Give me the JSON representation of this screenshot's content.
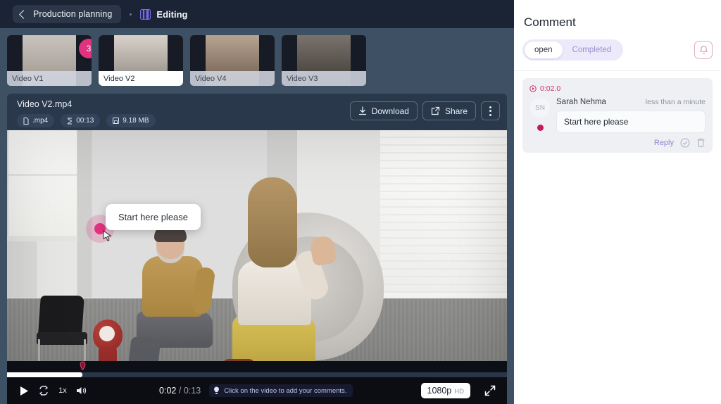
{
  "header": {
    "back_label": "Production planning",
    "back_icon": "chevron-left-icon",
    "separator": "•",
    "section_icon": "film-strip-icon",
    "section_label": "Editing"
  },
  "thumbnails": [
    {
      "label": "Video V1",
      "badge": "3",
      "selected": false
    },
    {
      "label": "Video V2",
      "badge": "",
      "selected": true
    },
    {
      "label": "Video V4",
      "badge": "",
      "selected": false
    },
    {
      "label": "Video V3",
      "badge": "",
      "selected": false
    }
  ],
  "file_info": {
    "name": "Video V2.mp4",
    "chips": [
      {
        "icon": "file-icon",
        "label": ".mp4"
      },
      {
        "icon": "hourglass-icon",
        "label": "00:13"
      },
      {
        "icon": "save-disk-icon",
        "label": "9.18 MB"
      }
    ],
    "download_label": "Download",
    "download_icon": "download-icon",
    "share_label": "Share",
    "share_icon": "external-link-icon",
    "more_icon": "kebab-menu-icon"
  },
  "player": {
    "play_icon": "play-icon",
    "loop_icon": "loop-icon",
    "speed_label": "1x",
    "volume_icon": "volume-icon",
    "current_time": "0:02",
    "time_separator": "/",
    "total_time": "0:13",
    "hint_icon": "lightbulb-icon",
    "hint_text": "Click on the video to add your comments.",
    "quality_label": "1080p",
    "quality_badge": "HD",
    "fullscreen_icon": "fullscreen-icon",
    "progress_percent": 15,
    "marker_percent": 15,
    "annotation_text": "Start here please",
    "annotation_icon": "comment-pin-icon",
    "cursor_icon": "pointer-cursor-icon"
  },
  "comments_panel": {
    "title": "Comment",
    "tabs": [
      {
        "label": "open",
        "active": true
      },
      {
        "label": "Completed",
        "active": false
      }
    ],
    "bell_icon": "bell-icon",
    "items": [
      {
        "timestamp": "0:02.0",
        "timestamp_icon": "play-circle-icon",
        "avatar_initials": "SN",
        "author": "Sarah Nehma",
        "age": "less than a minute",
        "text": "Start here please",
        "reply_label": "Reply",
        "resolve_icon": "check-circle-icon",
        "delete_icon": "trash-icon"
      }
    ]
  },
  "colors": {
    "accent_pink": "#e0327e",
    "accent_purple": "#7b6be8",
    "panel_dark": "#3e5064",
    "topbar_dark": "#1b2434",
    "comment_red": "#d0315f"
  }
}
